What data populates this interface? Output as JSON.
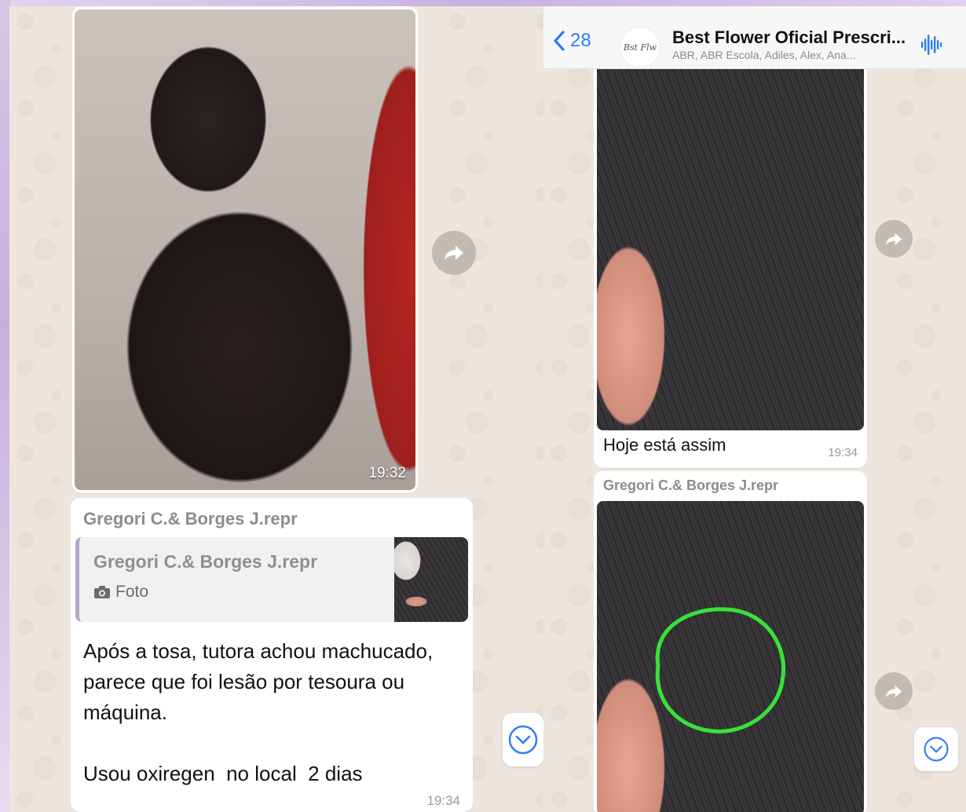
{
  "colors": {
    "chat_background": "#eee6dc",
    "bubble": "#ffffff",
    "accent": "#2f7cf6",
    "quote_bar": "#b4a6c9",
    "highlight_circle": "#39e23a"
  },
  "header": {
    "back_count": "28",
    "group_name": "Best Flower Oficial Prescri...",
    "members": "ABR, ABR Escola, Adiles, Alex, Ana...",
    "avatar_label": "Bst Flw",
    "icons": [
      "chevron-left-icon",
      "voice-waveform-icon"
    ]
  },
  "left_panel": {
    "photo_message": {
      "time": "19:32"
    },
    "reply_message": {
      "sender": "Gregori C.& Borges J.repr",
      "quote": {
        "sender": "Gregori C.& Borges J.repr",
        "type": "Foto"
      },
      "text": "Após a tosa, tutora achou machucado, parece que foi lesão por tesoura ou máquina.\n\nUsou oxiregen  no local  2 dias",
      "time": "19:34"
    }
  },
  "right_panel": {
    "photo_message_1": {
      "caption": "Hoje está assim",
      "time": "19:34"
    },
    "photo_message_2": {
      "sender": "Gregori C.& Borges J.repr"
    }
  }
}
